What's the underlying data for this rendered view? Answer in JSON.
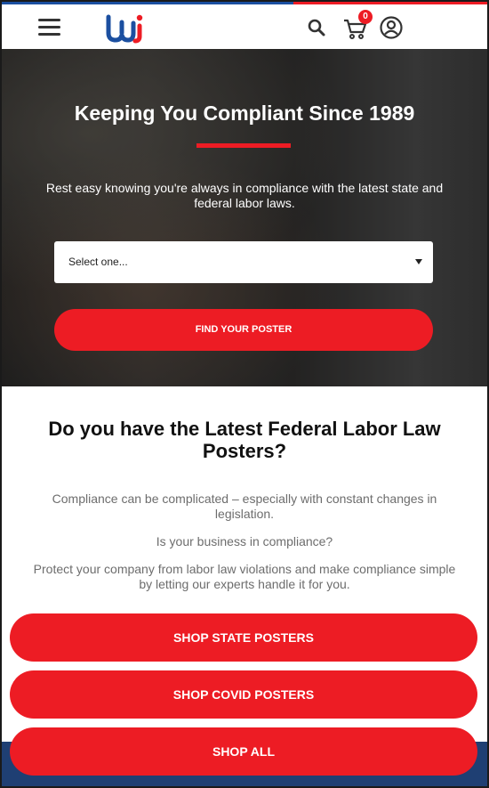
{
  "header": {
    "logo_name": "wj-logo",
    "cart_count": "0",
    "colors": {
      "brand_blue": "#1b4fa0",
      "brand_red": "#ed1c24"
    }
  },
  "hero": {
    "title": "Keeping You Compliant Since 1989",
    "subtitle": "Rest easy knowing you're always in compliance with the latest state and federal labor laws.",
    "select_value": "Select one...",
    "find_button_label": "FIND YOUR POSTER"
  },
  "main": {
    "title": "Do you have the Latest Federal Labor Law Posters?",
    "paragraphs": [
      "Compliance can be complicated – especially with constant changes in legislation.",
      "Is your business in compliance?",
      "Protect your company from labor law violations and make compliance simple by letting our experts handle it for you."
    ],
    "buttons": [
      "SHOP STATE POSTERS",
      "SHOP COVID POSTERS",
      "SHOP ALL"
    ]
  }
}
